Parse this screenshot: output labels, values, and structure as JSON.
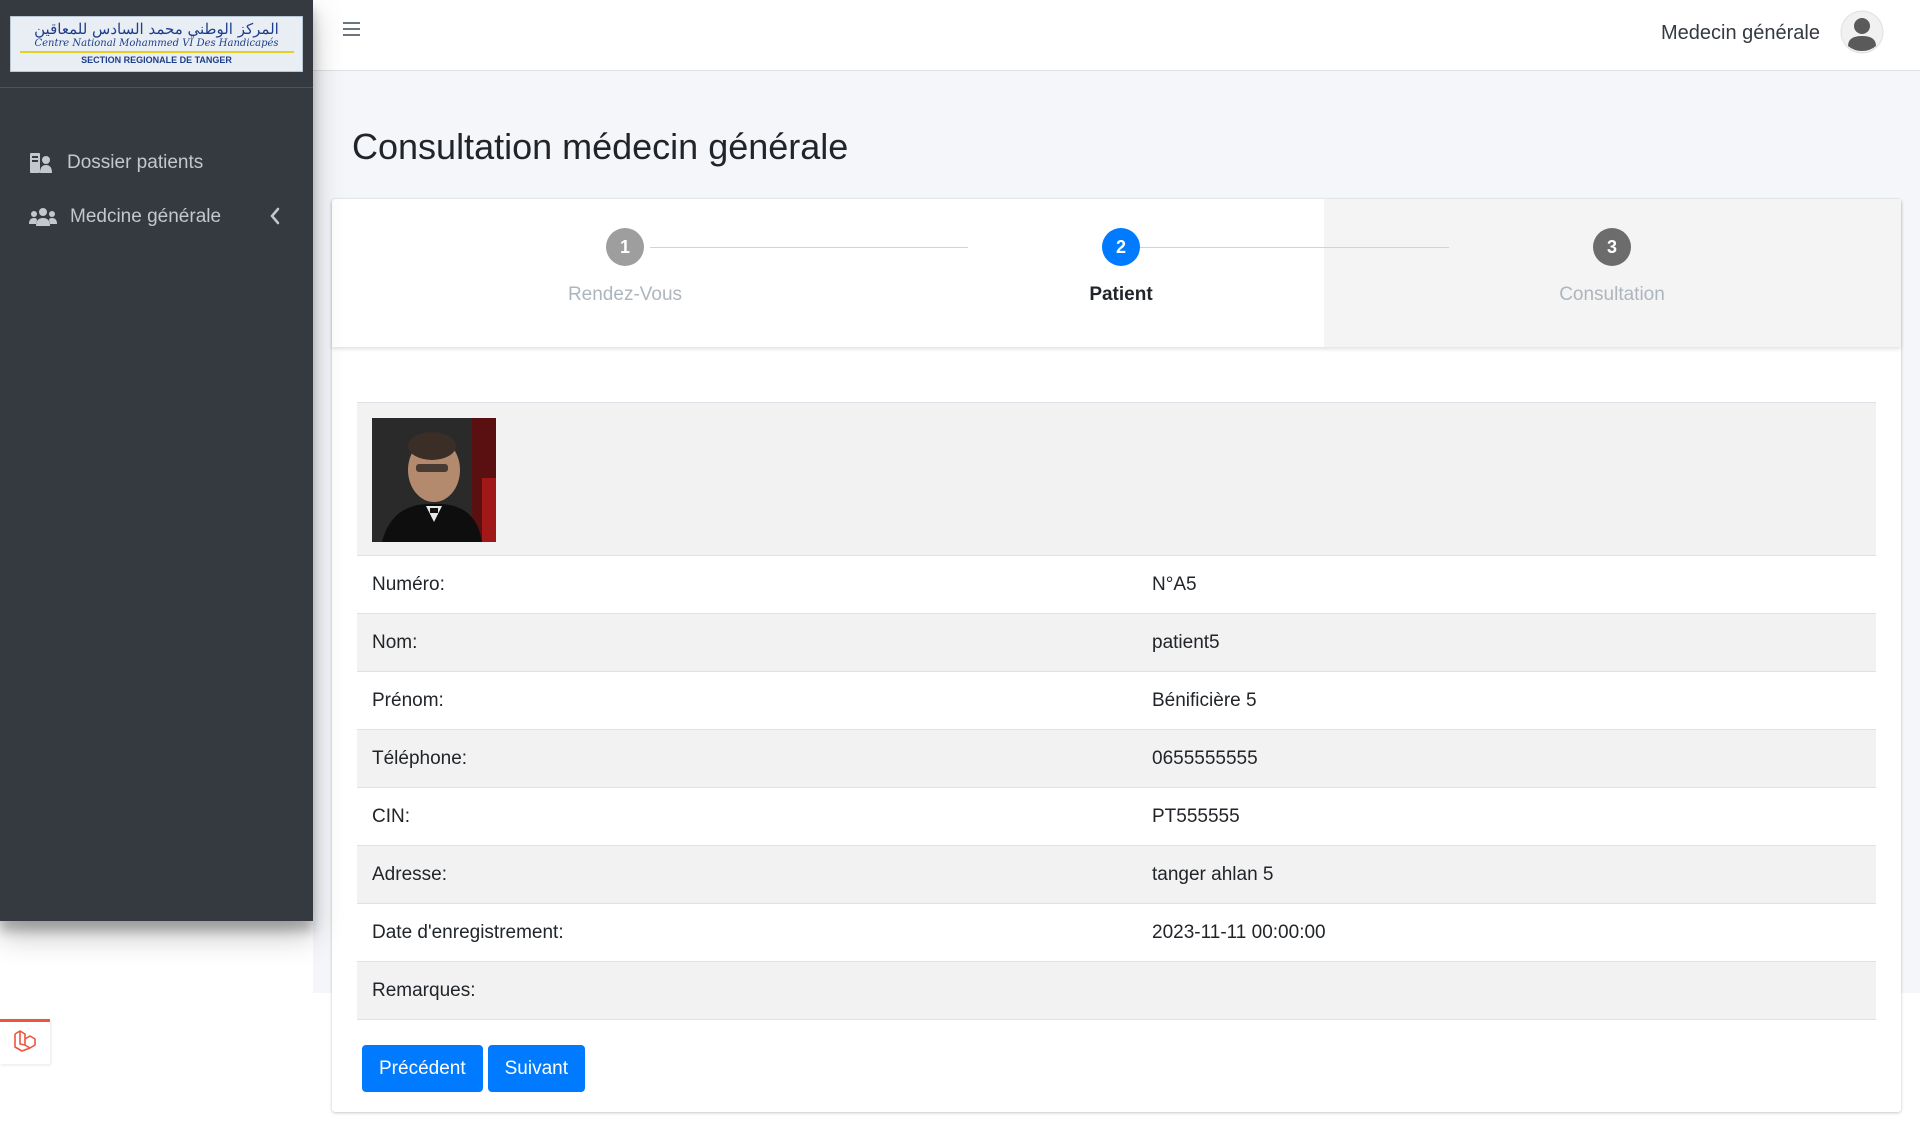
{
  "sidebar": {
    "logo": {
      "arabic": "المركز الوطني محمد السادس للمعاقين",
      "latin": "Centre National Mohammed VI Des Handicapés",
      "section": "SECTION REGIONALE DE TANGER"
    },
    "items": [
      {
        "label": "Dossier patients",
        "icon": "patient-file-icon"
      },
      {
        "label": "Medcine générale",
        "icon": "users-icon"
      }
    ]
  },
  "header": {
    "user_name": "Medecin générale"
  },
  "page": {
    "title": "Consultation médecin générale"
  },
  "stepper": {
    "active_index": 1,
    "steps": [
      {
        "number": "1",
        "label": "Rendez-Vous",
        "state": "done"
      },
      {
        "number": "2",
        "label": "Patient",
        "state": "active"
      },
      {
        "number": "3",
        "label": "Consultation",
        "state": "pending"
      }
    ]
  },
  "patient": {
    "fields": [
      {
        "label": "Numéro:",
        "value": "N°A5"
      },
      {
        "label": "Nom:",
        "value": "patient5"
      },
      {
        "label": "Prénom:",
        "value": "Bénificière 5"
      },
      {
        "label": "Téléphone:",
        "value": "0655555555"
      },
      {
        "label": "CIN:",
        "value": "PT555555"
      },
      {
        "label": "Adresse:",
        "value": "tanger ahlan 5"
      },
      {
        "label": "Date d'enregistrement:",
        "value": "2023-11-11 00:00:00"
      },
      {
        "label": "Remarques:",
        "value": ""
      }
    ]
  },
  "actions": {
    "prev_label": "Précédent",
    "next_label": "Suivant"
  },
  "colors": {
    "sidebar_bg": "#343a40",
    "primary": "#007bff",
    "step_done": "#9e9e9e",
    "step_active": "#007bff",
    "step_pending": "#6c6c6c",
    "laravel_red": "#f05340"
  }
}
